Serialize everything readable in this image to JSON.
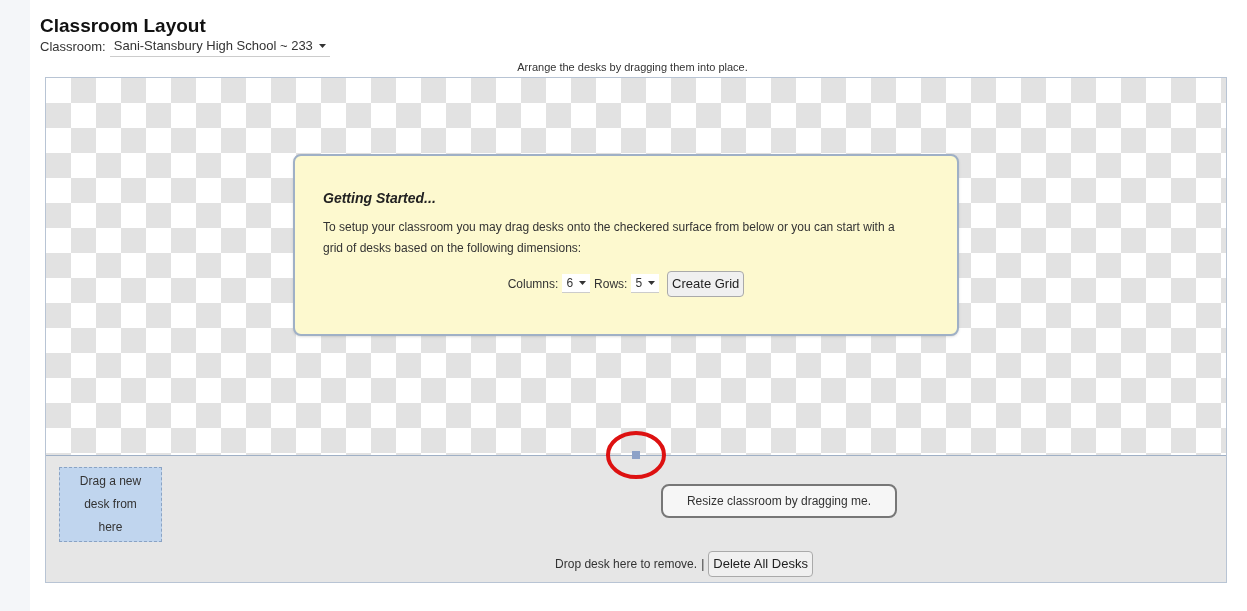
{
  "title": "Classroom Layout",
  "classroom": {
    "label": "Classroom:",
    "value": "Sani-Stansbury High School ~ 233"
  },
  "instruction": "Arrange the desks by dragging them into place.",
  "dialog": {
    "title": "Getting Started...",
    "text": "To setup your classroom you may drag desks onto the checkered surface from below or you can start with a grid of desks based on the following dimensions:",
    "columns": {
      "label": "Columns:",
      "value": "6"
    },
    "rows": {
      "label": "Rows:",
      "value": "5"
    },
    "button": "Create Grid"
  },
  "resize_tooltip": "Resize classroom by dragging me.",
  "new_desk": "Drag a new desk from here",
  "drop_text": "Drop desk here to remove.",
  "separator": "|",
  "delete_button": "Delete All Desks"
}
